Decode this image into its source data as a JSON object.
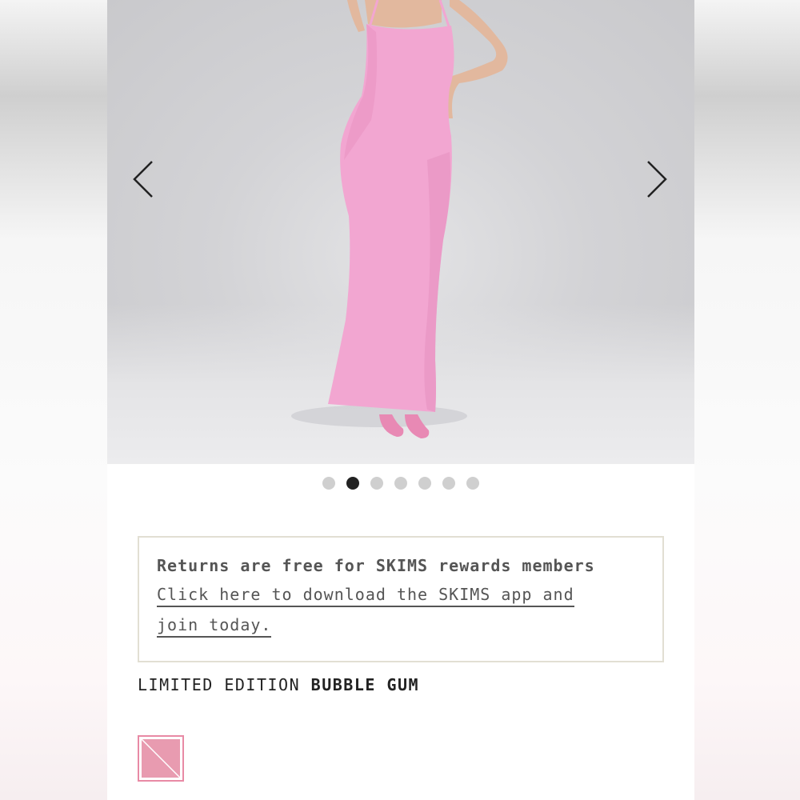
{
  "gallery": {
    "prev_icon": "chevron-left-icon",
    "next_icon": "chevron-right-icon",
    "slide_count": 7,
    "active_index": 1
  },
  "promo": {
    "headline": "Returns are free for SKIMS rewards members",
    "link_line1": "Click here to download the SKIMS app and",
    "link_line2": "join today."
  },
  "color": {
    "prefix": "LIMITED EDITION",
    "name": "BUBBLE GUM",
    "swatch_color": "#e89bb0",
    "swatch_border": "#e88aa5"
  },
  "colors": {
    "dress": "#f2a6d1",
    "active_dot": "#222222",
    "inactive_dot": "#cfcfcf",
    "promo_border": "#e2dfd3"
  }
}
